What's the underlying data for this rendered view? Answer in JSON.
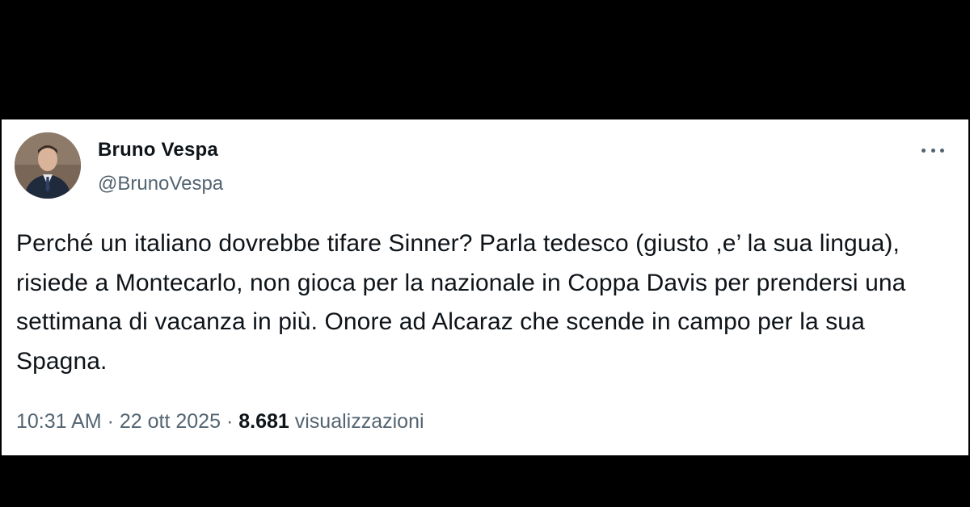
{
  "tweet": {
    "author": {
      "display_name": "Bruno Vespa",
      "handle": "@BrunoVespa",
      "avatar_icon": "profile-photo"
    },
    "more_icon": "more-horizontal-icon",
    "text": "Perché un italiano dovrebbe tifare Sinner? Parla tedesco (giusto ,e’ la sua lingua), risiede a Montecarlo, non gioca per la nazionale in Coppa Davis per prendersi una settimana di vacanza in più. Onore ad Alcaraz che scende in campo per la sua Spagna.",
    "time": "10:31 AM",
    "separator": "·",
    "date": "22 ott 2025",
    "views_count": "8.681",
    "views_label": "visualizzazioni"
  },
  "colors": {
    "background": "#000000",
    "card": "#ffffff",
    "primary_text": "#0f1419",
    "secondary_text": "#536471"
  }
}
